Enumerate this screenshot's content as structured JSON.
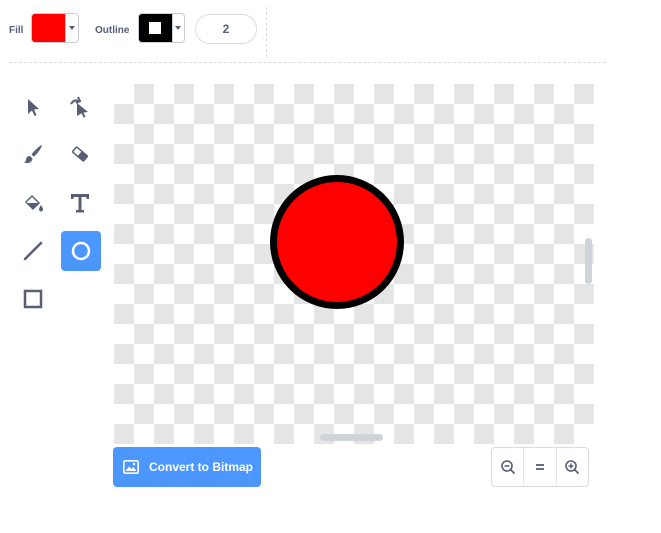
{
  "toolbar": {
    "fill_label": "Fill",
    "outline_label": "Outline",
    "fill_color": "#ff0000",
    "outline_color": "#000000",
    "outline_width": "2"
  },
  "tools": [
    {
      "name": "select",
      "icon": "arrow-select-icon",
      "selected": false
    },
    {
      "name": "reshape",
      "icon": "reshape-icon",
      "selected": false
    },
    {
      "name": "brush",
      "icon": "brush-icon",
      "selected": false
    },
    {
      "name": "eraser",
      "icon": "eraser-icon",
      "selected": false
    },
    {
      "name": "fill",
      "icon": "paint-bucket-icon",
      "selected": false
    },
    {
      "name": "text",
      "icon": "text-icon",
      "selected": false
    },
    {
      "name": "line",
      "icon": "line-icon",
      "selected": false
    },
    {
      "name": "circle",
      "icon": "circle-icon",
      "selected": true
    },
    {
      "name": "rectangle",
      "icon": "rectangle-icon",
      "selected": false
    }
  ],
  "canvas": {
    "shape": "circle",
    "shape_fill": "#ff0000",
    "shape_stroke": "#000000"
  },
  "bottom": {
    "convert_label": "Convert to Bitmap",
    "zoom_out_icon": "zoom-out-icon",
    "zoom_reset_icon": "equals-icon",
    "zoom_in_icon": "zoom-in-icon"
  },
  "colors": {
    "accent": "#4c97ff",
    "icon": "#575e75"
  }
}
